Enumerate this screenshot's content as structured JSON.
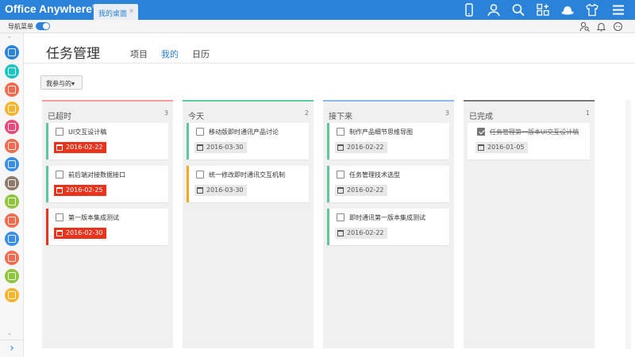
{
  "app": {
    "logo": "Office Anywhere",
    "logo_mark": "®"
  },
  "topbar": {
    "tab_label": "我的桌面",
    "tab_close": "×",
    "icons": [
      "mobile-icon",
      "user-icon",
      "search-icon",
      "apps-icon",
      "hat-icon",
      "shirt-icon",
      "menu-icon"
    ]
  },
  "navbar": {
    "label": "导航菜单",
    "toggle_on": true,
    "icons": [
      "user-search-icon",
      "bell-icon",
      "chat-icon"
    ]
  },
  "sidebar": {
    "up_arrow": "⌃",
    "down_arrow": "⌄",
    "expand": "›",
    "items": [
      {
        "name": "sidebar-item-share-icon",
        "color": "#2b82d9"
      },
      {
        "name": "sidebar-item-person-icon",
        "color": "#1ec5c5"
      },
      {
        "name": "sidebar-item-doc-icon",
        "color": "#f26b4e"
      },
      {
        "name": "sidebar-item-mail-icon",
        "color": "#f6b42c"
      },
      {
        "name": "sidebar-item-book-icon",
        "color": "#e84a79"
      },
      {
        "name": "sidebar-item-file-icon",
        "color": "#f26b4e"
      },
      {
        "name": "sidebar-item-notes-icon",
        "color": "#3a8ee6"
      },
      {
        "name": "sidebar-item-hr-icon",
        "color": "#8e7b6c"
      },
      {
        "name": "sidebar-item-calendar-icon",
        "color": "#8fc43d"
      },
      {
        "name": "sidebar-item-chart-icon",
        "color": "#f26b4e"
      },
      {
        "name": "sidebar-item-star-icon",
        "color": "#3a8ee6"
      },
      {
        "name": "sidebar-item-edit-icon",
        "color": "#f26b4e"
      },
      {
        "name": "sidebar-item-stats-icon",
        "color": "#8fc43d"
      },
      {
        "name": "sidebar-item-msg-icon",
        "color": "#f6b42c"
      }
    ]
  },
  "page": {
    "title": "任务管理",
    "tabs": [
      {
        "label": "项目",
        "active": false
      },
      {
        "label": "我的",
        "active": true
      },
      {
        "label": "日历",
        "active": false
      }
    ],
    "filter_label": "我参与的▾"
  },
  "columns": [
    {
      "title": "已超时",
      "count": "3",
      "color": "#f29c9c",
      "cards": [
        {
          "title": "UI交互设计稿",
          "date": "2016-02-22",
          "accent": "#5bc79b",
          "overdue": true,
          "done": false
        },
        {
          "title": "前后端对接数据接口",
          "date": "2016-02-25",
          "accent": "#5bc79b",
          "overdue": true,
          "done": false
        },
        {
          "title": "第一版本集成测试",
          "date": "2016-02-30",
          "accent": "#e8341c",
          "overdue": true,
          "done": false
        }
      ]
    },
    {
      "title": "今天",
      "count": "2",
      "color": "#5bc79b",
      "cards": [
        {
          "title": "移动版即时通讯产品讨论",
          "date": "2016-03-30",
          "accent": "#5bc79b",
          "overdue": false,
          "done": false
        },
        {
          "title": "统一修改即时通讯交互机制",
          "date": "2016-03-30",
          "accent": "#f6a623",
          "overdue": false,
          "done": false
        }
      ]
    },
    {
      "title": "接下来",
      "count": "3",
      "color": "#8ab8e8",
      "cards": [
        {
          "title": "制作产品细节思维导图",
          "date": "2016-02-22",
          "accent": "#5bc79b",
          "overdue": false,
          "done": false
        },
        {
          "title": "任务管理技术选型",
          "date": "2016-02-22",
          "accent": "#5bc79b",
          "overdue": false,
          "done": false
        },
        {
          "title": "即时通讯第一版本集成测试",
          "date": "2016-02-22",
          "accent": "#5bc79b",
          "overdue": false,
          "done": false
        }
      ]
    },
    {
      "title": "已完成",
      "count": "1",
      "color": "#777777",
      "cards": [
        {
          "title": "任务管理第一版本UI交互设计稿",
          "date": "2016-01-05",
          "accent": "#ffffff",
          "overdue": false,
          "done": true
        }
      ]
    }
  ]
}
